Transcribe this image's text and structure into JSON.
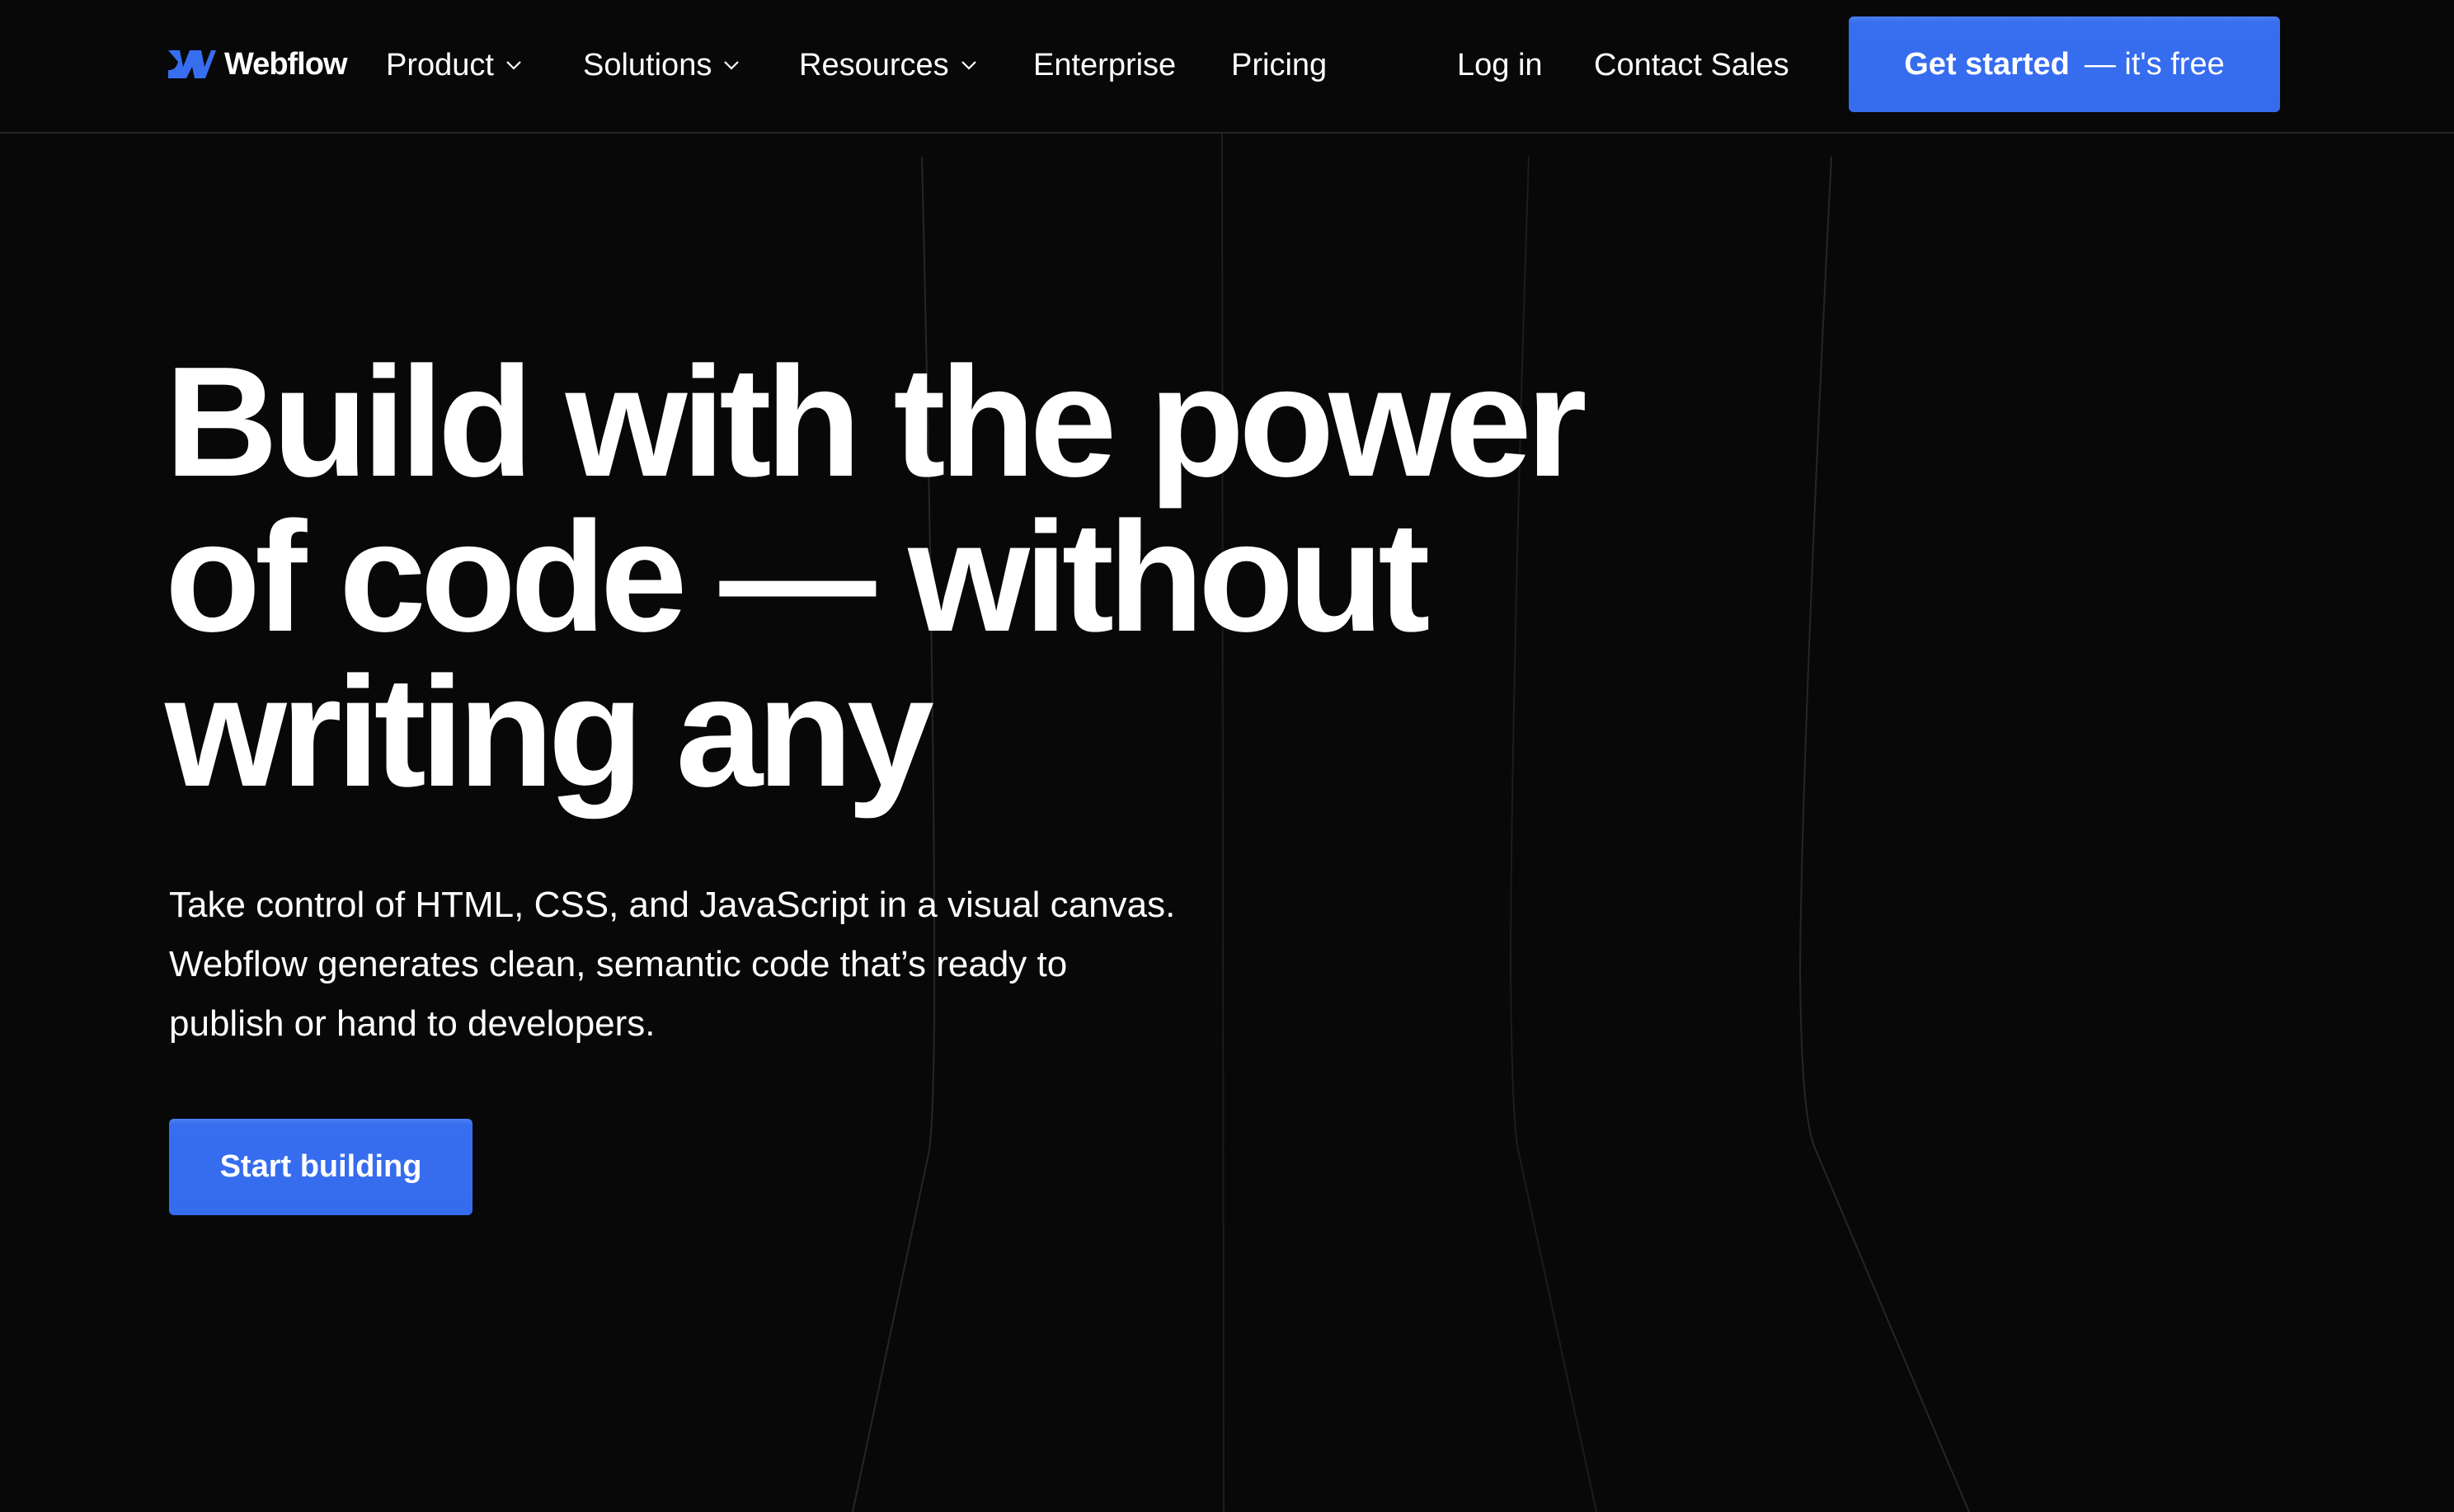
{
  "brand": {
    "name": "Webflow",
    "logo_icon": "webflow-w-logo",
    "accent_color": "#376DEF",
    "background_color": "#080808"
  },
  "nav": {
    "items": [
      {
        "label": "Product",
        "has_dropdown": true
      },
      {
        "label": "Solutions",
        "has_dropdown": true
      },
      {
        "label": "Resources",
        "has_dropdown": true
      },
      {
        "label": "Enterprise",
        "has_dropdown": false
      },
      {
        "label": "Pricing",
        "has_dropdown": false
      }
    ],
    "login_label": "Log in",
    "contact_label": "Contact Sales",
    "cta": {
      "primary": "Get started",
      "secondary": "— it's free"
    }
  },
  "hero": {
    "title_lines": [
      "Build with the power",
      "of code — without",
      "writing any"
    ],
    "subtitle_lines": [
      "Take control of HTML, CSS, and JavaScript in a visual canvas.",
      "Webflow generates clean, semantic code that’s ready to",
      "publish or hand to developers."
    ],
    "button_label": "Start building"
  }
}
